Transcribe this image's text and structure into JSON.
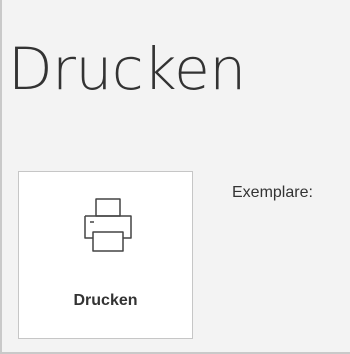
{
  "page": {
    "title": "Drucken"
  },
  "print_button": {
    "label": "Drucken",
    "icon": "printer-icon"
  },
  "copies": {
    "label": "Exemplare:"
  },
  "colors": {
    "background": "#f3f3f3",
    "button_background": "#ffffff",
    "border": "#c6c6c6",
    "text": "#333333"
  }
}
